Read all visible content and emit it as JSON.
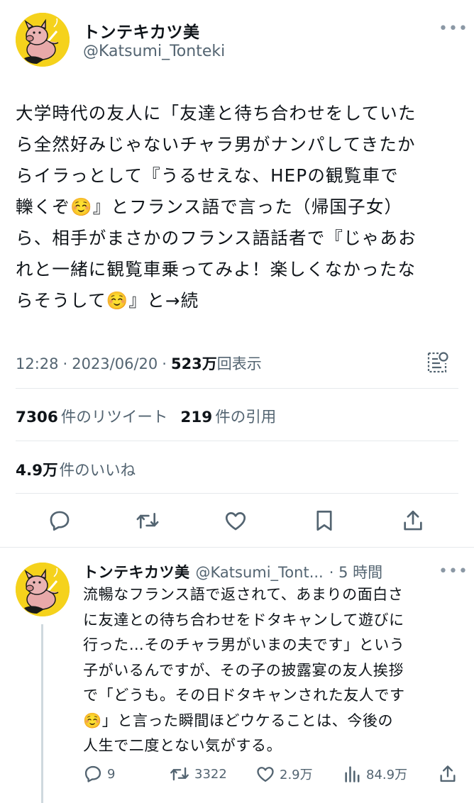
{
  "tweet": {
    "display_name": "トンテキカツ美",
    "handle": "@Katsumi_Tonteki",
    "more": "•••",
    "lines": [
      "大学時代の友人に「友達と待ち合わせをしていた",
      "ら全然好みじゃないチャラ男がナンパしてきたか",
      "らイラっとして『うるせえな、HEPの観覧車で",
      "轢くぞ☺️』とフランス語で言った（帰国子女）",
      "ら、相手がまさかのフランス語話者で『じゃあお",
      "れと一緒に観覧車乗ってみよ！楽しくなかったな",
      "らそうして☺️』と→続"
    ],
    "time": "12:28",
    "sep": "·",
    "date": "2023/06/20",
    "sep2": "·",
    "views_num": "523万",
    "views_label": "回表示",
    "retweets_num": "7306",
    "retweets_label": "件のリツイート",
    "quotes_num": "219",
    "quotes_label": "件の引用",
    "likes_num": "4.9万",
    "likes_label": "件のいいね"
  },
  "actions": [
    "reply",
    "retweet",
    "like",
    "bookmark",
    "share"
  ],
  "reply": {
    "display_name": "トンテキカツ美",
    "handle": "@Katsumi_Tont...",
    "time": "· 5 時間",
    "more": "•••",
    "lines": [
      "流暢なフランス語で返されて、あまりの面白さ",
      "に友達との待ち合わせをドタキャンして遊びに",
      "行った…そのチャラ男がいまの夫です」という",
      "子がいるんですが、その子の披露宴の友人挨拶",
      "で「どうも。その日ドタキャンされた友人です",
      "☺️」と言った瞬間ほどウケることは、今後の",
      "人生で二度とない気がする。"
    ],
    "reply_count": "9",
    "retweet_count": "3322",
    "like_count": "2.9万",
    "view_count": "84.9万"
  },
  "colors": {
    "text": "#0f1419",
    "secondary": "#536471",
    "avatar_bg": "#f5d21c",
    "divider": "#e6e9ec"
  }
}
